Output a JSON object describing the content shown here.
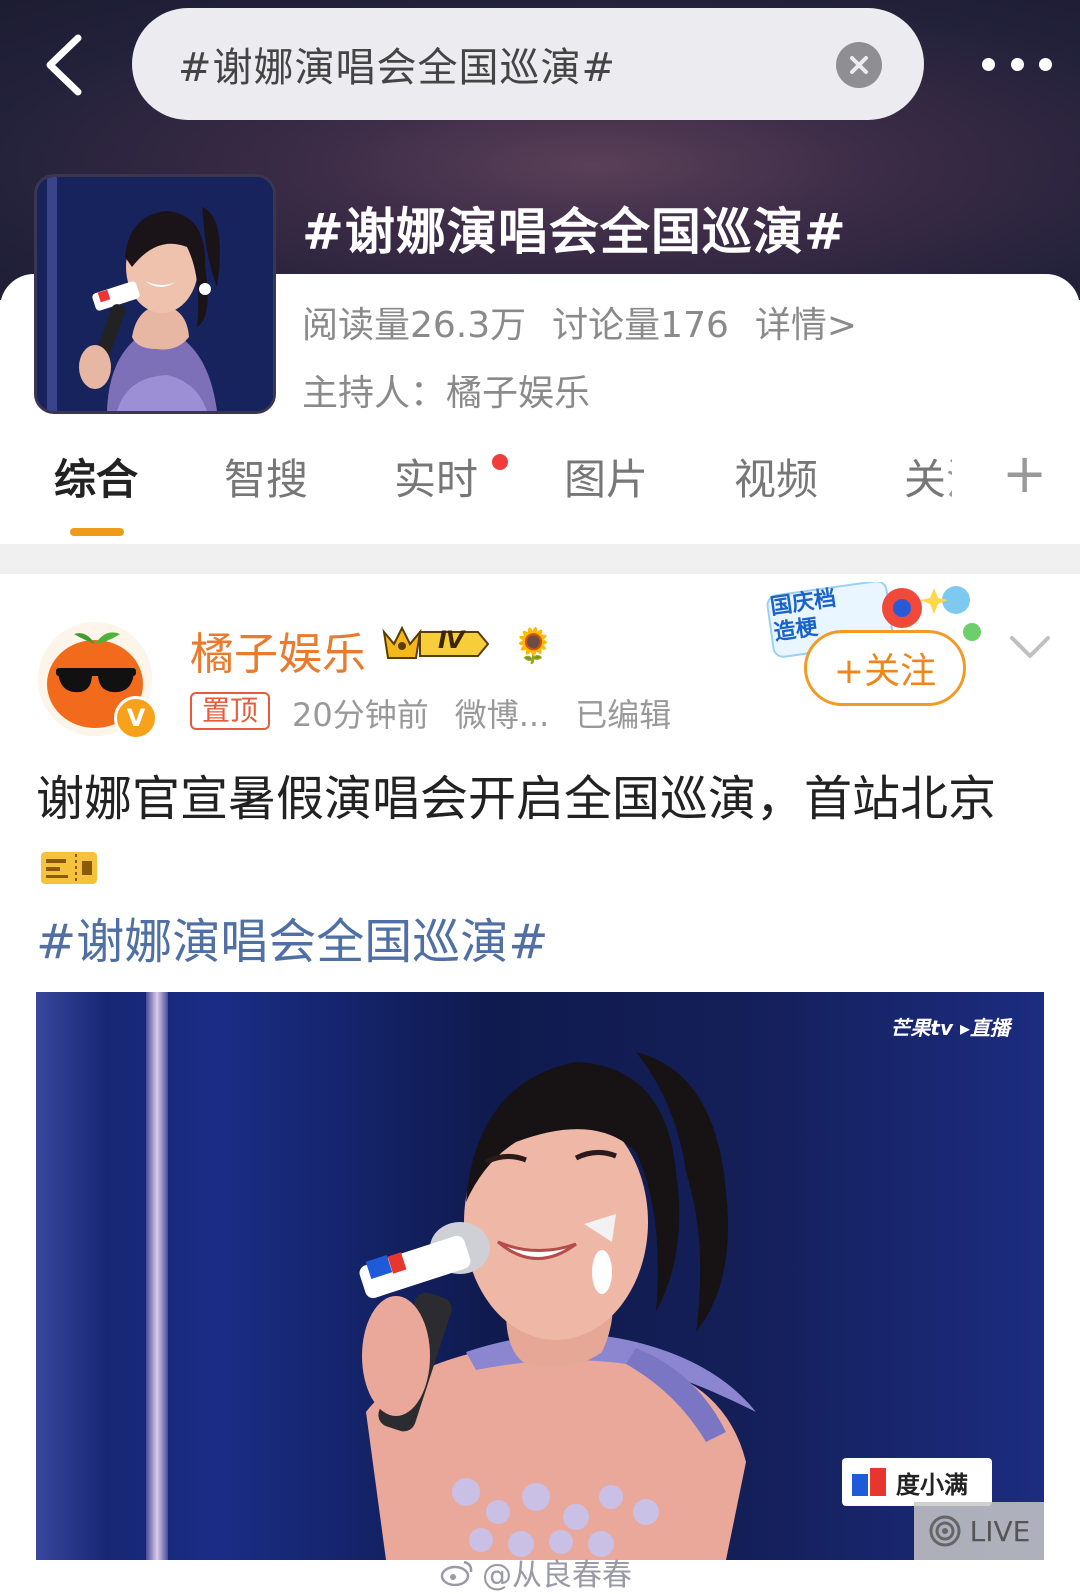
{
  "search": {
    "query": "#谢娜演唱会全国巡演#"
  },
  "topic": {
    "title": "#谢娜演唱会全国巡演#",
    "reads": "阅读量26.3万",
    "discussions": "讨论量176",
    "detail_link": "详情>",
    "host": "主持人：橘子娱乐"
  },
  "tabs": [
    {
      "label": "综合",
      "active": true
    },
    {
      "label": "智搜"
    },
    {
      "label": "实时",
      "has_dot": true
    },
    {
      "label": "图片"
    },
    {
      "label": "视频"
    },
    {
      "label": "关注"
    }
  ],
  "post": {
    "author": "橘子娱乐",
    "level": "Ⅳ",
    "verified_mark": "V",
    "pinned_label": "置顶",
    "time": "20分钟前",
    "source": "微博...",
    "edited": "已编辑",
    "follow_label": "+关注",
    "promo_label": "国庆档造梗",
    "text": "谢娜官宣暑假演唱会开启全国巡演，首站北京",
    "hashtag": "#谢娜演唱会全国巡演#"
  },
  "media": {
    "channel": "芒果tv ▸直播",
    "mic_brand": "度小满",
    "sponsor": "度小满",
    "live_label": "LIVE"
  },
  "watermark": "@从良春春",
  "colors": {
    "header_bg": "#2a2640",
    "accent_orange": "#f09a1a",
    "author_orange": "#eb7b2c",
    "hashtag_blue": "#506fa4",
    "tab_dot_red": "#f23c3c"
  }
}
